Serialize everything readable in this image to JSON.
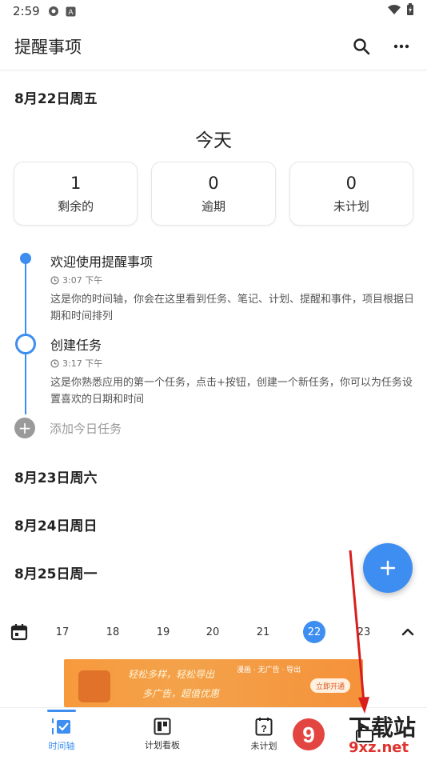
{
  "status_bar": {
    "time": "2:59"
  },
  "app_bar": {
    "title": "提醒事项",
    "search_icon": "search-icon",
    "more_icon": "more-horizontal-icon"
  },
  "day_today": {
    "date": "8月22日周五",
    "label": "今天"
  },
  "stats": [
    {
      "value": "1",
      "label": "剩余的"
    },
    {
      "value": "0",
      "label": "逾期"
    },
    {
      "value": "0",
      "label": "未计划"
    }
  ],
  "tasks": [
    {
      "title": "欢迎使用提醒事项",
      "time": "3:07 下午",
      "desc": "这是你的时间轴，你会在这里看到任务、笔记、计划、提醒和事件，项目根据日期和时间排列"
    },
    {
      "title": "创建任务",
      "time": "3:17 下午",
      "desc": "这是你熟悉应用的第一个任务，点击+按钮，创建一个新任务，你可以为任务设置喜欢的日期和时间"
    }
  ],
  "add_today": "添加今日任务",
  "upcoming_days": [
    "8月23日周六",
    "8月24日周日",
    "8月25日周一"
  ],
  "week_strip": {
    "days": [
      "17",
      "18",
      "19",
      "20",
      "21",
      "22",
      "23"
    ],
    "selected": "22"
  },
  "ad": {
    "line1": "轻松多样，轻松导出",
    "line2": "多广告，超值优惠",
    "tags": "漫画 · 无广告 · 导出",
    "button": "立即开通"
  },
  "bottom_nav": [
    {
      "label": "时间轴",
      "icon": "timeline-icon",
      "active": true
    },
    {
      "label": "计划看板",
      "icon": "board-icon",
      "active": false
    },
    {
      "label": "未计划",
      "icon": "unplanned-icon",
      "active": false
    },
    {
      "label": "",
      "icon": "briefcase-icon",
      "active": false
    }
  ],
  "watermark": {
    "brand": "下载站",
    "domain": "9xz.net"
  },
  "colors": {
    "accent": "#3d8ef0",
    "ad_orange": "#f79a3c",
    "watermark_red": "#e0312b"
  }
}
